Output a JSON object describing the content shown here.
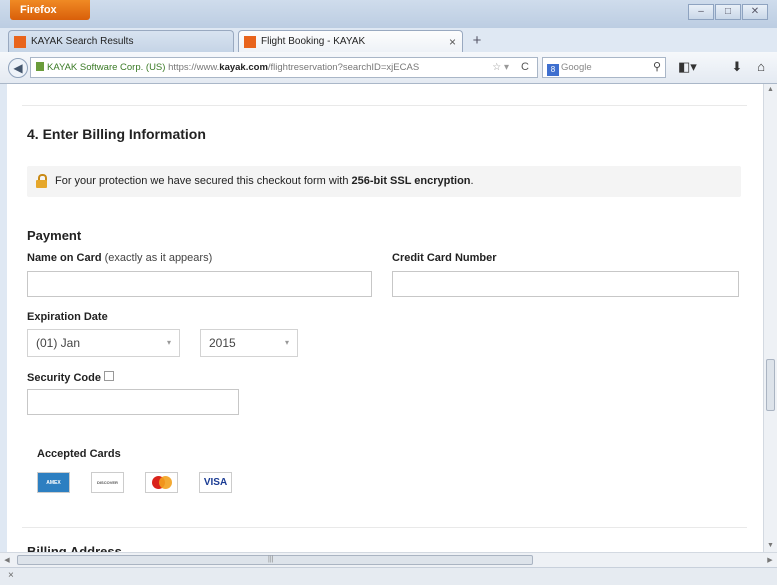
{
  "browser": {
    "app_button": "Firefox",
    "tabs": [
      {
        "label": "KAYAK Search Results"
      },
      {
        "label": "Flight Booking - KAYAK"
      }
    ],
    "identity": "KAYAK Software Corp. (US)",
    "url_prefix": "https://www.",
    "url_domain": "kayak.com",
    "url_path": "/flightreservation?searchID=xjECAS",
    "search_placeholder": "Google",
    "status_text": "×"
  },
  "form": {
    "section_title": "4. Enter Billing Information",
    "ssl_prefix": "For your protection we have secured this checkout form with ",
    "ssl_bold": "256-bit SSL encryption",
    "ssl_suffix": ".",
    "payment_heading": "Payment",
    "name_label": "Name on Card",
    "name_note": "(exactly as it appears)",
    "name_value": "",
    "cc_label": "Credit Card Number",
    "cc_value": "",
    "exp_label": "Expiration Date",
    "exp_month": "(01) Jan",
    "exp_year": "2015",
    "sec_label": "Security Code",
    "sec_value": "",
    "accepted_label": "Accepted Cards",
    "cards": [
      "AMEX",
      "DISCOVER",
      "MasterCard",
      "VISA"
    ],
    "billing_heading": "Billing Address"
  }
}
